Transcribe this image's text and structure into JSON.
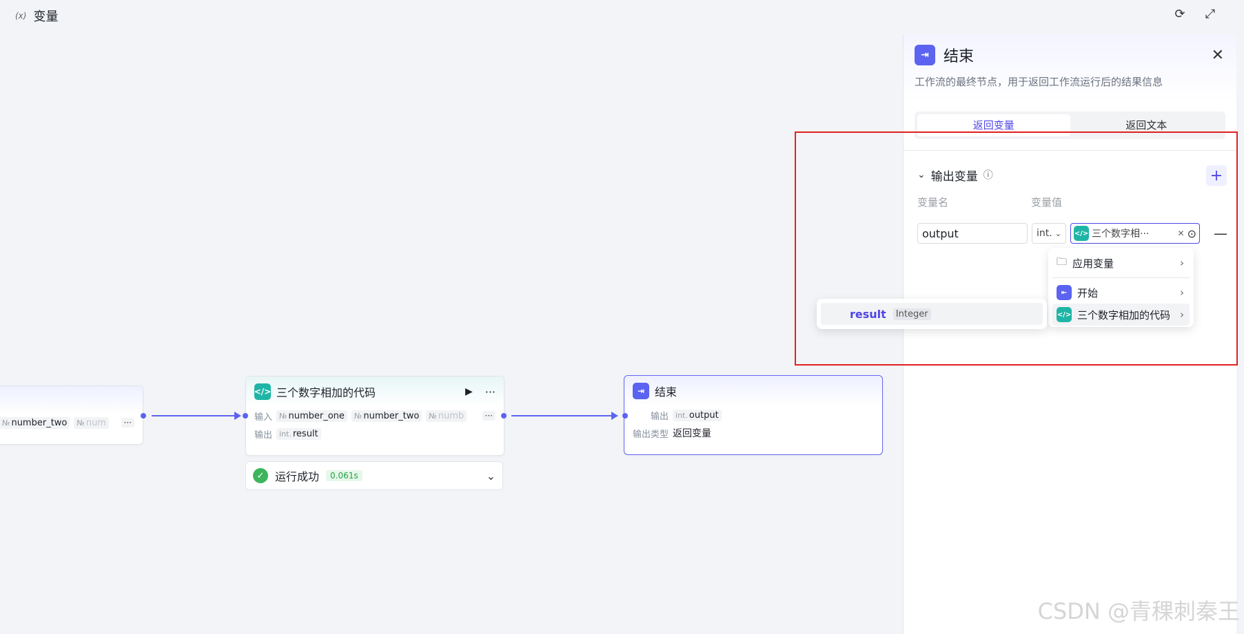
{
  "topbar": {
    "variable_icon": "(x)",
    "variable_label": "变量"
  },
  "canvas": {
    "left_node": {
      "input_two": "number_two",
      "input_three": "num"
    },
    "code_node": {
      "title": "三个数字相加的代码",
      "input_label": "输入",
      "inputs": [
        "number_one",
        "number_two",
        "numb"
      ],
      "output_label": "输出",
      "output_type": "int.",
      "output": "result"
    },
    "status": {
      "text": "运行成功",
      "time": "0.061s"
    },
    "end_node": {
      "title": "结束",
      "output_label": "输出",
      "output_type": "int.",
      "output": "output",
      "output_kind_label": "输出类型",
      "output_kind": "返回变量"
    }
  },
  "panel": {
    "title": "结束",
    "description": "工作流的最终节点，用于返回工作流运行后的结果信息",
    "tabs": [
      {
        "label": "返回变量"
      },
      {
        "label": "返回文本"
      }
    ],
    "section_title": "输出变量",
    "col_name": "变量名",
    "col_value": "变量值",
    "row": {
      "name": "output",
      "type": "int.",
      "value": "三个数字相···"
    }
  },
  "dropdown": {
    "items": [
      {
        "label": "应用变量"
      },
      {
        "label": "开始"
      },
      {
        "label": "三个数字相加的代码"
      }
    ]
  },
  "submenu": {
    "name": "result",
    "type": "Integer"
  },
  "watermark": "CSDN @青稞刺秦王",
  "colors": {
    "accent": "#4f46e5",
    "edge": "#5b63f0",
    "teal": "#1fb5a6",
    "success": "#3cb55c",
    "highlight": "#e02020"
  }
}
